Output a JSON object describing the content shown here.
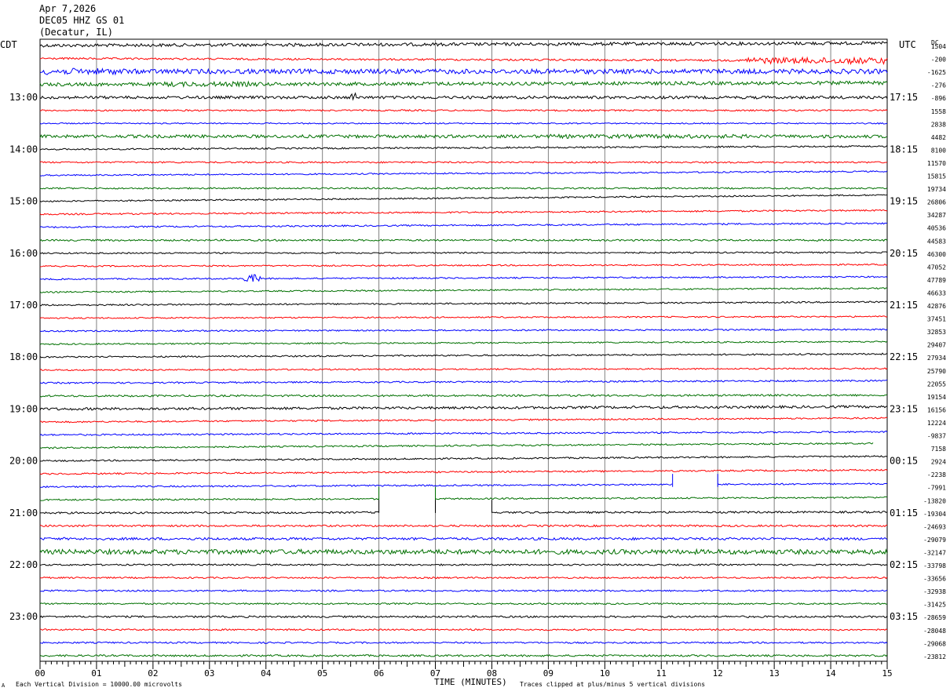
{
  "header": {
    "date": "Apr 7,2026",
    "station": "DEC05 HHZ GS 01",
    "location": "(Decatur, IL)"
  },
  "labels": {
    "left_tz": "CDT",
    "right_tz": "UTC",
    "dc": "DC"
  },
  "footer": {
    "scale": "Each Vertical Division = 10000.00 microvolts",
    "axis_title": "TIME (MINUTES)",
    "clip_note": "Traces clipped at plus/minus 5 vertical divisions",
    "mark": "A"
  },
  "colors": {
    "cycle": [
      "#000000",
      "#ff0000",
      "#0000ff",
      "#007000"
    ],
    "grid": "#808080"
  },
  "chart_data": {
    "type": "line",
    "title": "DEC05 HHZ GS 01 (Decatur, IL)",
    "xlabel": "TIME (MINUTES)",
    "x_range": [
      0,
      15
    ],
    "x_ticks": [
      "00",
      "01",
      "02",
      "03",
      "04",
      "05",
      "06",
      "07",
      "08",
      "09",
      "10",
      "11",
      "12",
      "13",
      "14",
      "15"
    ],
    "rows_per_hour": 4,
    "row_minutes": 15,
    "traces": 48,
    "left_hour_labels": [
      "13:00",
      "14:00",
      "15:00",
      "16:00",
      "17:00",
      "18:00",
      "19:00",
      "20:00",
      "21:00",
      "22:00",
      "23:00"
    ],
    "right_hour_labels": [
      "17:15",
      "18:15",
      "19:15",
      "20:15",
      "21:15",
      "22:15",
      "23:15",
      "00:15",
      "01:15",
      "02:15",
      "03:15"
    ],
    "first_hour_label_row": 4,
    "dc_offsets": [
      "1504",
      "-200",
      "-1625",
      "-276",
      "-896",
      "1558",
      "2838",
      "4482",
      "8100",
      "11570",
      "15815",
      "19734",
      "26806",
      "34287",
      "40536",
      "44583",
      "46300",
      "47052",
      "47789",
      "46633",
      "42876",
      "37451",
      "32853",
      "29407",
      "27934",
      "25790",
      "22055",
      "19154",
      "16156",
      "12224",
      "-9837",
      "7158",
      "2924",
      "-2238",
      "-7991",
      "-13820",
      "-19304",
      "-24693",
      "-29079",
      "-32147",
      "-33798",
      "-33656",
      "-32938",
      "-31425",
      "-28659",
      "-28048",
      "-29068",
      "-23812"
    ],
    "amplitudes": [
      2.0,
      1.2,
      3.0,
      2.2,
      1.8,
      1.0,
      0.8,
      2.0,
      1.0,
      1.0,
      0.9,
      1.0,
      0.9,
      1.0,
      1.0,
      1.1,
      0.9,
      0.9,
      0.9,
      0.9,
      1.0,
      0.9,
      0.9,
      0.9,
      1.0,
      0.9,
      1.0,
      1.2,
      1.6,
      1.0,
      1.0,
      1.0,
      1.0,
      1.0,
      1.0,
      1.0,
      1.2,
      1.2,
      1.6,
      2.4,
      1.0,
      1.0,
      1.0,
      1.0,
      1.2,
      1.0,
      1.0,
      1.2
    ],
    "trend_end": [
      -3,
      3,
      0,
      -2,
      0,
      0,
      0,
      0,
      -4,
      0,
      -5,
      0,
      -8,
      -5,
      -5,
      0,
      -1,
      -2,
      -3,
      -5,
      -4,
      -2,
      -2,
      -3,
      -4,
      -2,
      -3,
      -1,
      -3,
      -5,
      -4,
      -6,
      -6,
      -5,
      -4,
      -3,
      -1,
      0,
      0,
      0,
      0,
      0,
      0,
      0,
      0,
      0,
      0,
      0
    ],
    "trace_end_minutes": [
      15,
      15,
      15,
      15,
      15,
      15,
      15,
      15,
      15,
      15,
      15,
      15,
      15,
      15,
      15,
      15,
      15,
      15,
      15,
      15,
      15,
      15,
      15,
      15,
      15,
      15,
      15,
      15,
      15,
      15,
      15,
      14.75,
      15,
      15,
      15,
      15,
      15,
      15,
      15,
      15,
      15,
      15,
      15,
      15,
      15,
      15,
      15,
      15
    ],
    "gaps": [
      {
        "row": 34,
        "start_min": 11.2,
        "end_min": 12.0
      },
      {
        "row": 35,
        "start_min": 6.0,
        "end_min": 7.0
      },
      {
        "row": 36,
        "start_min": 6.0,
        "end_min": 7.0
      },
      {
        "row": 36,
        "start_min": 7.0,
        "end_min": 8.0
      }
    ],
    "events": [
      {
        "row": 2,
        "start_min": 0.0,
        "end_min": 1.5,
        "amp": 4
      },
      {
        "row": 1,
        "start_min": 12.5,
        "end_min": 15.0,
        "amp": 4
      },
      {
        "row": 3,
        "start_min": 2.2,
        "end_min": 3.9,
        "amp": 3
      },
      {
        "row": 4,
        "start_min": 5.5,
        "end_min": 5.6,
        "amp": 6
      },
      {
        "row": 7,
        "start_min": 9.0,
        "end_min": 12.5,
        "amp": 2.5
      },
      {
        "row": 18,
        "start_min": 3.6,
        "end_min": 3.9,
        "amp": 5
      },
      {
        "row": 39,
        "start_min": 0.0,
        "end_min": 15.0,
        "amp": 3
      }
    ]
  }
}
